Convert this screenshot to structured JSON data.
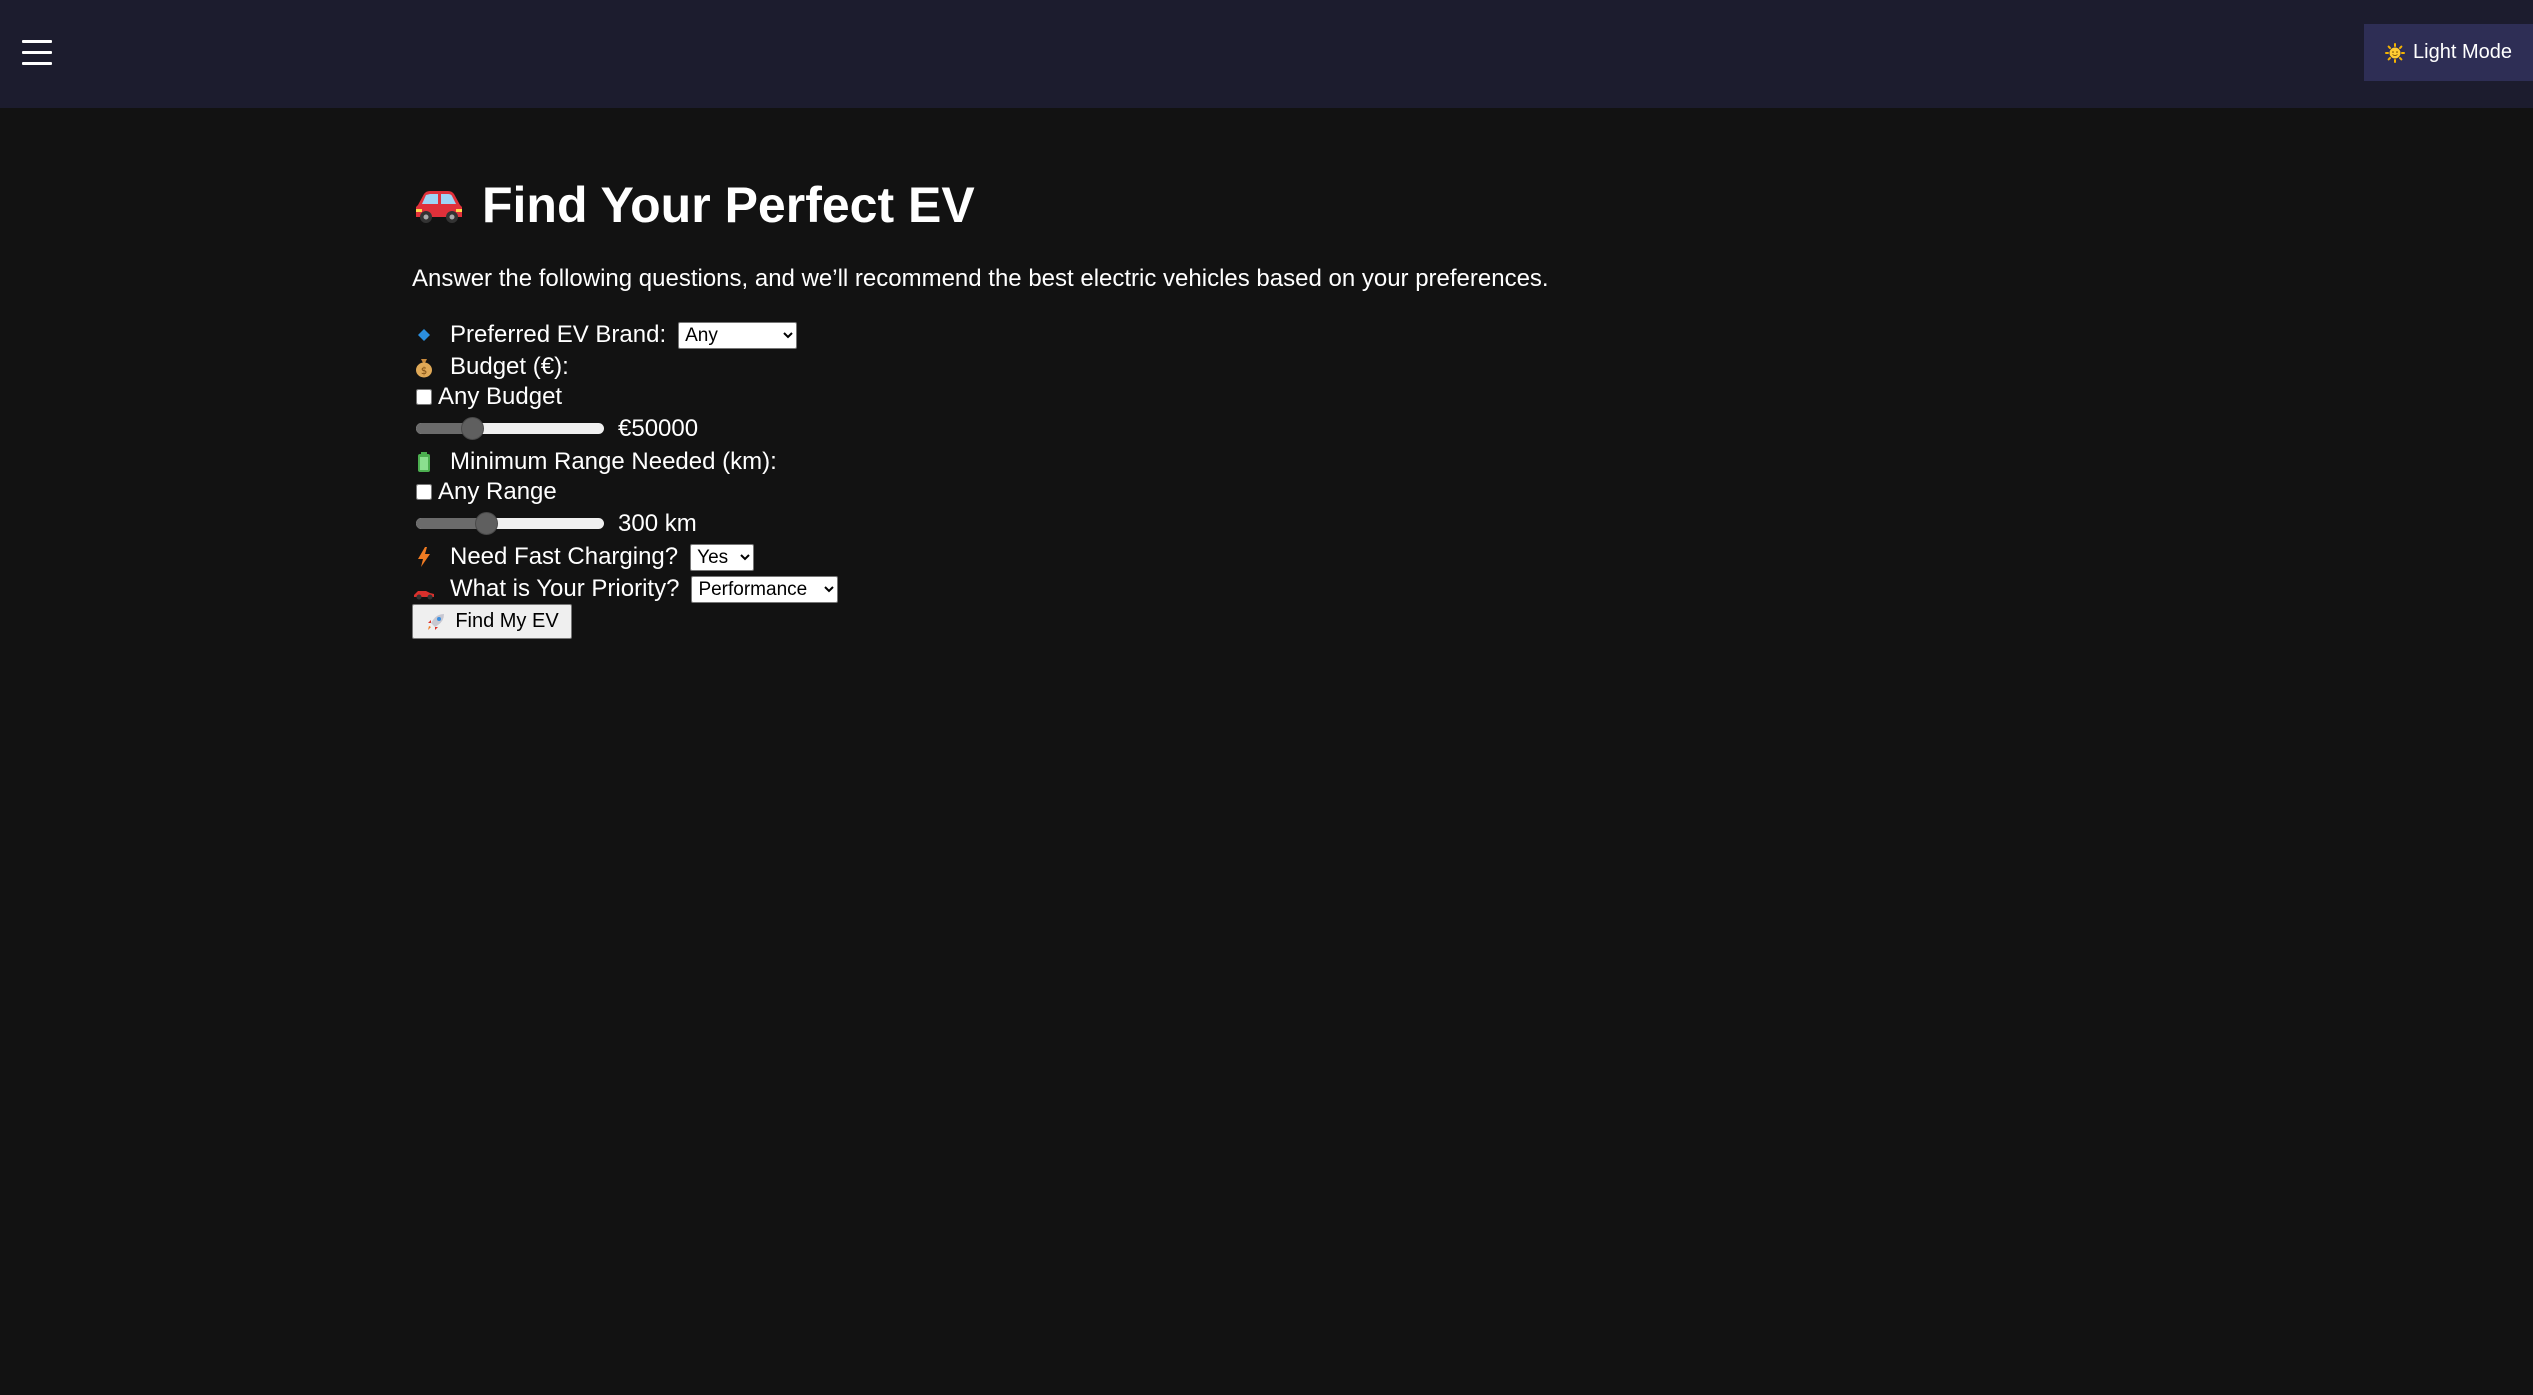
{
  "topbar": {
    "menu_icon": "hamburger-menu-icon",
    "theme_toggle": {
      "icon": "sun-icon",
      "label": "Light Mode"
    }
  },
  "header": {
    "title_icon": "car-icon",
    "title": "Find Your Perfect EV",
    "intro": "Answer the following questions, and we’ll recommend the best electric vehicles based on your preferences."
  },
  "form": {
    "brand": {
      "icon": "blue-diamond-icon",
      "label": "Preferred EV Brand:",
      "selected": "Any"
    },
    "budget": {
      "icon": "money-bag-icon",
      "label": "Budget (€):",
      "any_label": "Any Budget",
      "any_checked": false,
      "value_text": "€50000",
      "slider_fraction": 0.27
    },
    "range": {
      "icon": "battery-icon",
      "label": "Minimum Range Needed (km):",
      "any_label": "Any Range",
      "any_checked": false,
      "value_text": "300 km",
      "slider_fraction": 0.36
    },
    "fast_charging": {
      "icon": "lightning-icon",
      "label": "Need Fast Charging?",
      "selected": "Yes"
    },
    "priority": {
      "icon": "race-car-icon",
      "label": "What is Your Priority?",
      "selected": "Performance"
    },
    "submit": {
      "icon": "rocket-icon",
      "label": "Find My EV"
    }
  },
  "colors": {
    "background": "#121212",
    "topbar": "#1c1c2e",
    "theme_button": "#2e2e55",
    "text": "#ffffff"
  }
}
